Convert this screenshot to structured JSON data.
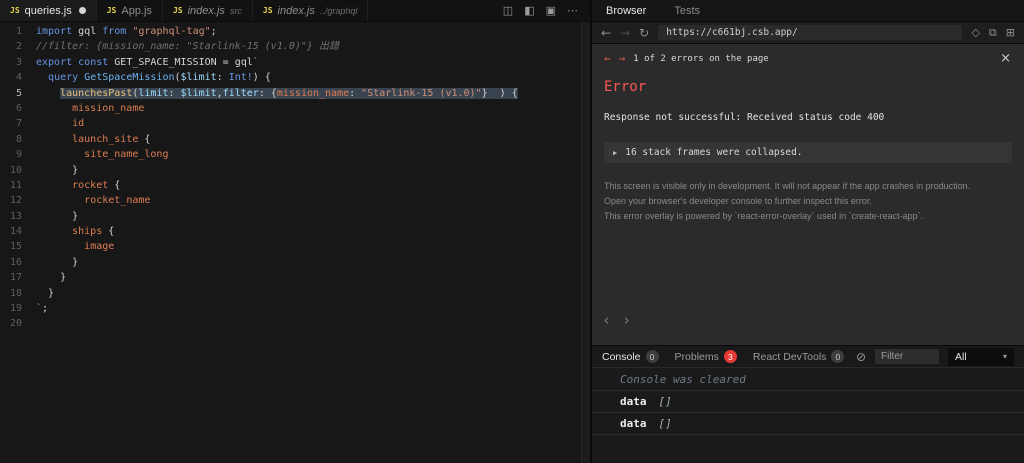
{
  "colors": {
    "error_red": "#ff5757",
    "overlay_bg": "#2b2b2b",
    "problems_badge_red": "#e53935",
    "keyword_blue": "#6796e6",
    "string_orange": "#ce9178",
    "field_orange": "#de7d53",
    "function_yellow": "#e6c07b",
    "line_highlight": "#3a4450",
    "js_icon_yellow": "#e8d44d"
  },
  "editor": {
    "tabs": [
      {
        "icon": "JS",
        "label": "queries.js",
        "modified": true,
        "active": true
      },
      {
        "icon": "JS",
        "label": "App.js"
      },
      {
        "icon": "JS",
        "label": "index.js",
        "dir": "src",
        "italic": true
      },
      {
        "icon": "JS",
        "label": "index.js",
        "dir": "../graphql",
        "italic": true
      }
    ],
    "action_icons": [
      {
        "name": "split-horizontal-icon",
        "glyph": "◫"
      },
      {
        "name": "split-vertical-icon",
        "glyph": "◧"
      },
      {
        "name": "layout-icon",
        "glyph": "▣"
      },
      {
        "name": "more-actions-icon",
        "glyph": "⋯"
      }
    ]
  },
  "code": {
    "lines": [
      {
        "n": 1,
        "seg": [
          [
            "kw",
            "import "
          ],
          [
            "pl",
            "gql "
          ],
          [
            "kw",
            "from "
          ],
          [
            "st",
            "\"graphql-tag\""
          ],
          [
            "pl",
            ";"
          ]
        ]
      },
      {
        "n": 2,
        "seg": [
          [
            "cm",
            "//filter: {mission_name: \"Starlink-15 (v1.0)\"} 出錯"
          ]
        ]
      },
      {
        "n": 3,
        "seg": [
          [
            "kw",
            "export "
          ],
          [
            "kw",
            "const "
          ],
          [
            "pl",
            "GET_SPACE_MISSION = gql"
          ],
          [
            "st",
            "`"
          ]
        ]
      },
      {
        "n": 4,
        "seg": [
          [
            "pl",
            "  "
          ],
          [
            "kw",
            "query "
          ],
          [
            "fn2",
            "GetSpaceMission"
          ],
          [
            "pl",
            "("
          ],
          [
            "var",
            "$limit"
          ],
          [
            "pl",
            ": "
          ],
          [
            "ty",
            "Int!"
          ],
          [
            "pl",
            ") {"
          ]
        ]
      },
      {
        "n": 5,
        "hl": 1,
        "cur": true,
        "seg": [
          [
            "pl",
            "    "
          ],
          [
            "fn",
            "launchesPast"
          ],
          [
            "pl",
            "("
          ],
          [
            "var",
            "limit"
          ],
          [
            "pl",
            ": "
          ],
          [
            "var",
            "$limit"
          ],
          [
            "pl",
            ","
          ],
          [
            "var",
            "filter"
          ],
          [
            "pl",
            ": {"
          ],
          [
            "fld",
            "mission_name"
          ],
          [
            "pl",
            ": "
          ],
          [
            "st",
            "\"Starlink-15 (v1.0)\""
          ],
          [
            "pl",
            "}  ) {"
          ]
        ]
      },
      {
        "n": 6,
        "seg": [
          [
            "pl",
            "      "
          ],
          [
            "fld",
            "mission_name"
          ]
        ]
      },
      {
        "n": 7,
        "seg": [
          [
            "pl",
            "      "
          ],
          [
            "fld",
            "id"
          ]
        ]
      },
      {
        "n": 8,
        "seg": [
          [
            "pl",
            "      "
          ],
          [
            "fld",
            "launch_site"
          ],
          [
            "pl",
            " {"
          ]
        ]
      },
      {
        "n": 9,
        "seg": [
          [
            "pl",
            "        "
          ],
          [
            "fld",
            "site_name_long"
          ]
        ]
      },
      {
        "n": 10,
        "seg": [
          [
            "pl",
            "      }"
          ]
        ]
      },
      {
        "n": 11,
        "seg": [
          [
            "pl",
            "      "
          ],
          [
            "fld",
            "rocket"
          ],
          [
            "pl",
            " {"
          ]
        ]
      },
      {
        "n": 12,
        "seg": [
          [
            "pl",
            "        "
          ],
          [
            "fld",
            "rocket_name"
          ]
        ]
      },
      {
        "n": 13,
        "seg": [
          [
            "pl",
            "      }"
          ]
        ]
      },
      {
        "n": 14,
        "seg": [
          [
            "pl",
            "      "
          ],
          [
            "fld",
            "ships"
          ],
          [
            "pl",
            " {"
          ]
        ]
      },
      {
        "n": 15,
        "seg": [
          [
            "pl",
            "        "
          ],
          [
            "fld",
            "image"
          ]
        ]
      },
      {
        "n": 16,
        "seg": [
          [
            "pl",
            "      }"
          ]
        ]
      },
      {
        "n": 17,
        "seg": [
          [
            "pl",
            "    }"
          ]
        ]
      },
      {
        "n": 18,
        "seg": [
          [
            "pl",
            "  }"
          ]
        ]
      },
      {
        "n": 19,
        "seg": [
          [
            "st",
            "`"
          ],
          [
            "pl",
            ";"
          ]
        ]
      },
      {
        "n": 20,
        "seg": []
      }
    ]
  },
  "browser": {
    "nav_tabs": [
      {
        "label": "Browser",
        "active": true
      },
      {
        "label": "Tests",
        "active": false
      }
    ],
    "back_icon": "←",
    "forward_icon": "→",
    "refresh_icon": "↻",
    "url": "https://c661bj.csb.app/",
    "action_icons": [
      {
        "name": "responsive-mode-icon",
        "glyph": "◇"
      },
      {
        "name": "copy-url-icon",
        "glyph": "⧉"
      },
      {
        "name": "open-new-window-icon",
        "glyph": "⊞"
      }
    ]
  },
  "error_overlay": {
    "prev_icon": "←",
    "next_icon": "→",
    "counter": "1 of 2 errors on the page",
    "close_icon": "×",
    "title": "Error",
    "message": "Response not successful: Received status code 400",
    "collapsed_caret": "▶",
    "collapsed_text": "16 stack frames were collapsed.",
    "footer_lines": [
      "This screen is visible only in development. It will not appear if the app crashes in production.",
      "Open your browser's developer console to further inspect this error.",
      "This error overlay is powered by `react-error-overlay` used in `create-react-app`."
    ],
    "viewport_prev_icon": "‹",
    "viewport_next_icon": "›"
  },
  "console": {
    "tabs": [
      {
        "label": "Console",
        "badge": "0",
        "active": true
      },
      {
        "label": "Problems",
        "badge": "3",
        "red": true
      },
      {
        "label": "React DevTools",
        "badge": "0"
      }
    ],
    "clear_icon": "⊘",
    "filter_placeholder": "Filter",
    "level_selected": "All",
    "select_caret": "▾",
    "cleared_message": "Console was cleared",
    "rows": [
      {
        "name": "data",
        "value": "[]"
      },
      {
        "name": "data",
        "value": "[]"
      }
    ]
  }
}
